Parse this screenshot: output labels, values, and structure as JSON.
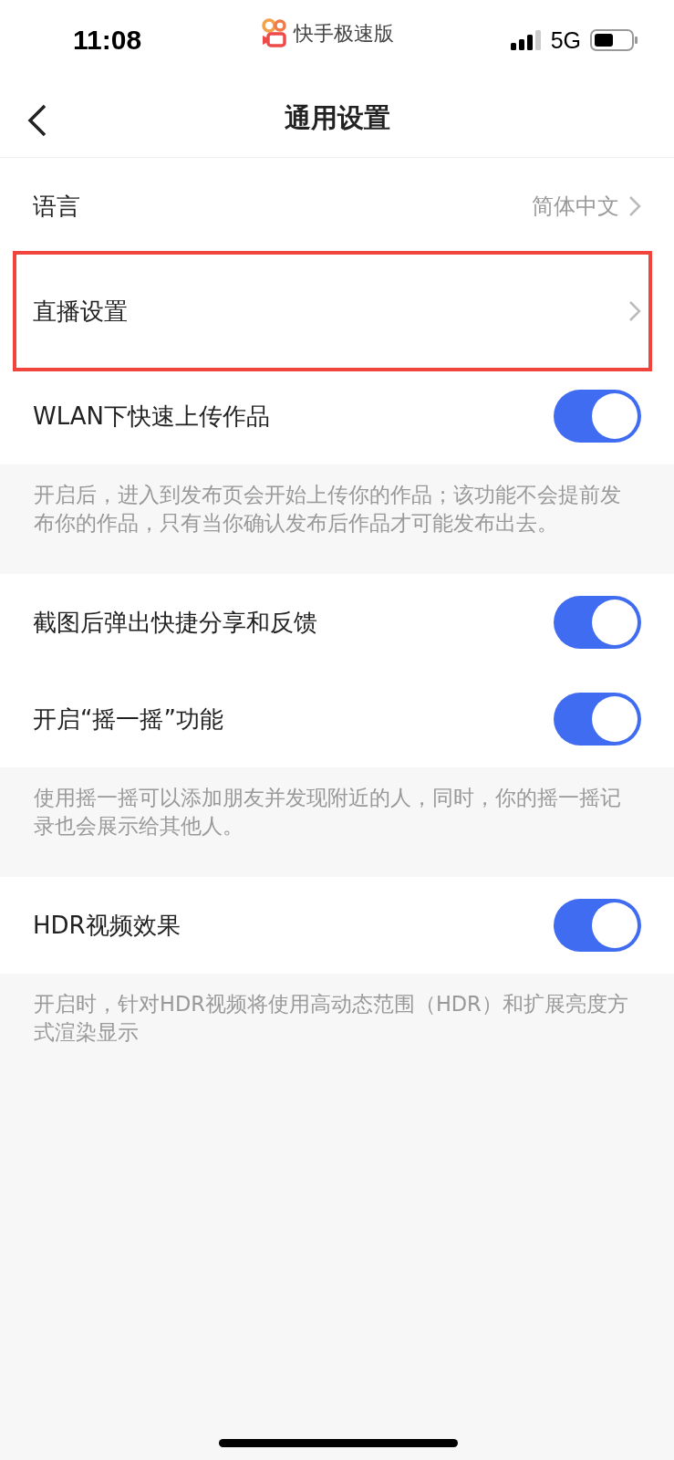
{
  "status_bar": {
    "time": "11:08",
    "app_name": "快手极速版",
    "network": "5G"
  },
  "nav": {
    "title": "通用设置"
  },
  "sections": [
    {
      "rows": [
        {
          "kind": "link",
          "label": "语言",
          "value": "简体中文"
        },
        {
          "kind": "link",
          "label": "直播设置",
          "highlighted": true
        },
        {
          "kind": "toggle",
          "label": "WLAN下快速上传作品",
          "on": true
        }
      ],
      "note": "开启后，进入到发布页会开始上传你的作品；该功能不会提前发布你的作品，只有当你确认发布后作品才可能发布出去。"
    },
    {
      "rows": [
        {
          "kind": "toggle",
          "label": "截图后弹出快捷分享和反馈",
          "on": true
        },
        {
          "kind": "toggle",
          "label": "开启“摇一摇”功能",
          "on": true
        }
      ],
      "note": "使用摇一摇可以添加朋友并发现附近的人，同时，你的摇一摇记录也会展示给其他人。"
    },
    {
      "rows": [
        {
          "kind": "toggle",
          "label": "HDR视频效果",
          "on": true
        }
      ],
      "note": "开启时，针对HDR视频将使用高动态范围（HDR）和扩展亮度方式渲染显示"
    }
  ]
}
